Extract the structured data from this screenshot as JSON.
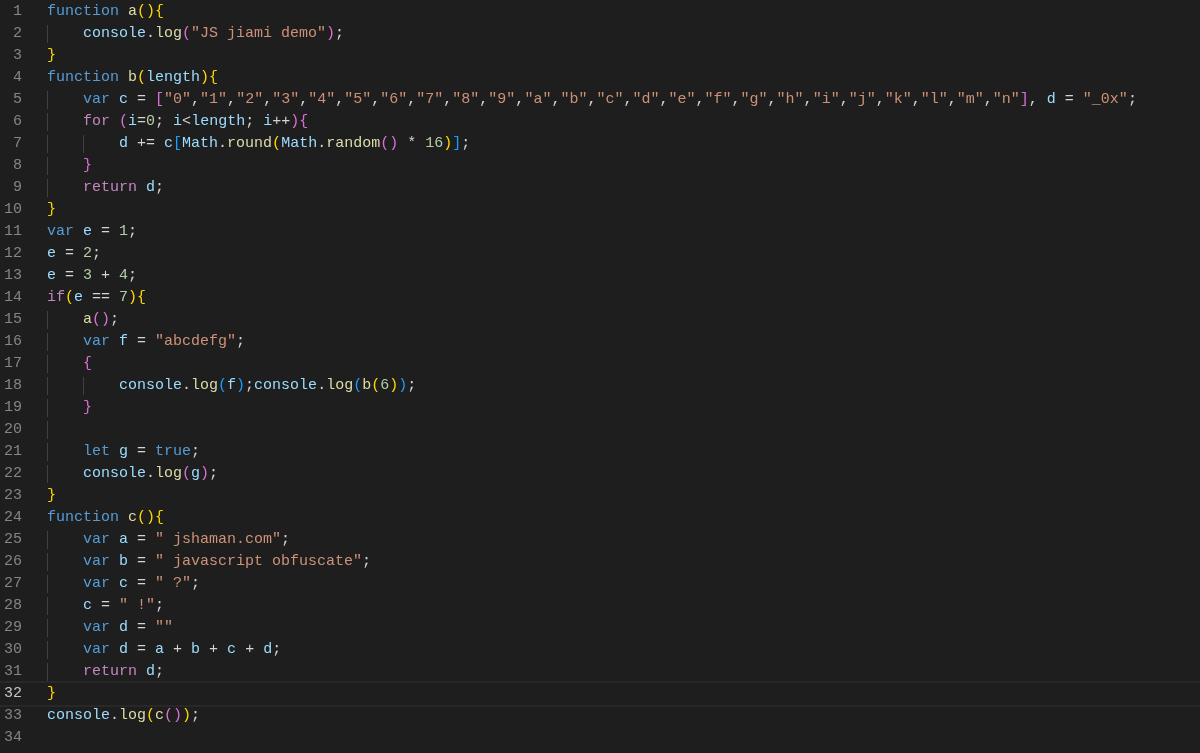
{
  "editor": {
    "lines": [
      {
        "number": "1",
        "current": false,
        "tokens": [
          {
            "text": "function",
            "kind": "keyword"
          },
          {
            "text": " a",
            "kind": "function"
          },
          {
            "text": "()",
            "kind": "bracket1"
          },
          {
            "text": "{",
            "kind": "bracket1"
          }
        ],
        "children": [
          {
            "number": "2",
            "current": false,
            "tokens": [
              {
                "text": "console",
                "kind": "variable"
              },
              {
                "text": ".",
                "kind": "plain"
              },
              {
                "text": "log",
                "kind": "function"
              },
              {
                "text": "(",
                "kind": "bracket2"
              },
              {
                "text": "\"JS jiami demo\"",
                "kind": "string"
              },
              {
                "text": ")",
                "kind": "bracket2"
              },
              {
                "text": ";",
                "kind": "plain"
              }
            ]
          }
        ]
      },
      {
        "number": "3",
        "current": false,
        "tokens": [
          {
            "text": "}",
            "kind": "bracket1"
          }
        ]
      },
      {
        "number": "4",
        "current": false,
        "tokens": [
          {
            "text": "function",
            "kind": "keyword"
          },
          {
            "text": " b",
            "kind": "function"
          },
          {
            "text": "(",
            "kind": "bracket1"
          },
          {
            "text": "length",
            "kind": "variable"
          },
          {
            "text": ")",
            "kind": "bracket1"
          },
          {
            "text": "{",
            "kind": "bracket1"
          }
        ],
        "children": [
          {
            "number": "5",
            "current": false,
            "tokens": [
              {
                "text": "var",
                "kind": "keyword"
              },
              {
                "text": " c",
                "kind": "variable"
              },
              {
                "text": " = ",
                "kind": "plain"
              },
              {
                "text": "[",
                "kind": "bracket2"
              },
              {
                "text": "\"0\"",
                "kind": "string"
              },
              {
                "text": ",",
                "kind": "plain"
              },
              {
                "text": "\"1\"",
                "kind": "string"
              },
              {
                "text": ",",
                "kind": "plain"
              },
              {
                "text": "\"2\"",
                "kind": "string"
              },
              {
                "text": ",",
                "kind": "plain"
              },
              {
                "text": "\"3\"",
                "kind": "string"
              },
              {
                "text": ",",
                "kind": "plain"
              },
              {
                "text": "\"4\"",
                "kind": "string"
              },
              {
                "text": ",",
                "kind": "plain"
              },
              {
                "text": "\"5\"",
                "kind": "string"
              },
              {
                "text": ",",
                "kind": "plain"
              },
              {
                "text": "\"6\"",
                "kind": "string"
              },
              {
                "text": ",",
                "kind": "plain"
              },
              {
                "text": "\"7\"",
                "kind": "string"
              },
              {
                "text": ",",
                "kind": "plain"
              },
              {
                "text": "\"8\"",
                "kind": "string"
              },
              {
                "text": ",",
                "kind": "plain"
              },
              {
                "text": "\"9\"",
                "kind": "string"
              },
              {
                "text": ",",
                "kind": "plain"
              },
              {
                "text": "\"a\"",
                "kind": "string"
              },
              {
                "text": ",",
                "kind": "plain"
              },
              {
                "text": "\"b\"",
                "kind": "string"
              },
              {
                "text": ",",
                "kind": "plain"
              },
              {
                "text": "\"c\"",
                "kind": "string"
              },
              {
                "text": ",",
                "kind": "plain"
              },
              {
                "text": "\"d\"",
                "kind": "string"
              },
              {
                "text": ",",
                "kind": "plain"
              },
              {
                "text": "\"e\"",
                "kind": "string"
              },
              {
                "text": ",",
                "kind": "plain"
              },
              {
                "text": "\"f\"",
                "kind": "string"
              },
              {
                "text": ",",
                "kind": "plain"
              },
              {
                "text": "\"g\"",
                "kind": "string"
              },
              {
                "text": ",",
                "kind": "plain"
              },
              {
                "text": "\"h\"",
                "kind": "string"
              },
              {
                "text": ",",
                "kind": "plain"
              },
              {
                "text": "\"i\"",
                "kind": "string"
              },
              {
                "text": ",",
                "kind": "plain"
              },
              {
                "text": "\"j\"",
                "kind": "string"
              },
              {
                "text": ",",
                "kind": "plain"
              },
              {
                "text": "\"k\"",
                "kind": "string"
              },
              {
                "text": ",",
                "kind": "plain"
              },
              {
                "text": "\"l\"",
                "kind": "string"
              },
              {
                "text": ",",
                "kind": "plain"
              },
              {
                "text": "\"m\"",
                "kind": "string"
              },
              {
                "text": ",",
                "kind": "plain"
              },
              {
                "text": "\"n\"",
                "kind": "string"
              },
              {
                "text": "]",
                "kind": "bracket2"
              },
              {
                "text": ", ",
                "kind": "plain"
              },
              {
                "text": "d",
                "kind": "variable"
              },
              {
                "text": " = ",
                "kind": "plain"
              },
              {
                "text": "\"_0x\"",
                "kind": "string"
              },
              {
                "text": ";",
                "kind": "plain"
              }
            ]
          },
          {
            "number": "6",
            "current": false,
            "tokens": [
              {
                "text": "for",
                "kind": "control"
              },
              {
                "text": " (",
                "kind": "bracket2"
              },
              {
                "text": "i",
                "kind": "variable"
              },
              {
                "text": "=",
                "kind": "plain"
              },
              {
                "text": "0",
                "kind": "number"
              },
              {
                "text": "; ",
                "kind": "plain"
              },
              {
                "text": "i",
                "kind": "variable"
              },
              {
                "text": "<",
                "kind": "plain"
              },
              {
                "text": "length",
                "kind": "variable"
              },
              {
                "text": "; ",
                "kind": "plain"
              },
              {
                "text": "i",
                "kind": "variable"
              },
              {
                "text": "++",
                "kind": "plain"
              },
              {
                "text": ")",
                "kind": "bracket2"
              },
              {
                "text": "{",
                "kind": "bracket2"
              }
            ],
            "children": [
              {
                "number": "7",
                "current": false,
                "tokens": [
                  {
                    "text": "d",
                    "kind": "variable"
                  },
                  {
                    "text": " += ",
                    "kind": "plain"
                  },
                  {
                    "text": "c",
                    "kind": "variable"
                  },
                  {
                    "text": "[",
                    "kind": "bracket3"
                  },
                  {
                    "text": "Math",
                    "kind": "variable"
                  },
                  {
                    "text": ".",
                    "kind": "plain"
                  },
                  {
                    "text": "round",
                    "kind": "function"
                  },
                  {
                    "text": "(",
                    "kind": "bracket1"
                  },
                  {
                    "text": "Math",
                    "kind": "variable"
                  },
                  {
                    "text": ".",
                    "kind": "plain"
                  },
                  {
                    "text": "random",
                    "kind": "function"
                  },
                  {
                    "text": "()",
                    "kind": "bracket2"
                  },
                  {
                    "text": " * ",
                    "kind": "plain"
                  },
                  {
                    "text": "16",
                    "kind": "number"
                  },
                  {
                    "text": ")",
                    "kind": "bracket1"
                  },
                  {
                    "text": "]",
                    "kind": "bracket3"
                  },
                  {
                    "text": ";",
                    "kind": "plain"
                  }
                ]
              }
            ]
          },
          {
            "number": "8",
            "current": false,
            "tokens": [
              {
                "text": "}",
                "kind": "bracket2"
              }
            ]
          },
          {
            "number": "9",
            "current": false,
            "tokens": [
              {
                "text": "return",
                "kind": "control"
              },
              {
                "text": " d",
                "kind": "variable"
              },
              {
                "text": ";",
                "kind": "plain"
              }
            ]
          }
        ]
      },
      {
        "number": "10",
        "current": false,
        "tokens": [
          {
            "text": "}",
            "kind": "bracket1"
          }
        ]
      },
      {
        "number": "11",
        "current": false,
        "tokens": [
          {
            "text": "var",
            "kind": "keyword"
          },
          {
            "text": " e",
            "kind": "variable"
          },
          {
            "text": " = ",
            "kind": "plain"
          },
          {
            "text": "1",
            "kind": "number"
          },
          {
            "text": ";",
            "kind": "plain"
          }
        ]
      },
      {
        "number": "12",
        "current": false,
        "tokens": [
          {
            "text": "e",
            "kind": "variable"
          },
          {
            "text": " = ",
            "kind": "plain"
          },
          {
            "text": "2",
            "kind": "number"
          },
          {
            "text": ";",
            "kind": "plain"
          }
        ]
      },
      {
        "number": "13",
        "current": false,
        "tokens": [
          {
            "text": "e",
            "kind": "variable"
          },
          {
            "text": " = ",
            "kind": "plain"
          },
          {
            "text": "3",
            "kind": "number"
          },
          {
            "text": " + ",
            "kind": "plain"
          },
          {
            "text": "4",
            "kind": "number"
          },
          {
            "text": ";",
            "kind": "plain"
          }
        ]
      },
      {
        "number": "14",
        "current": false,
        "tokens": [
          {
            "text": "if",
            "kind": "control"
          },
          {
            "text": "(",
            "kind": "bracket1"
          },
          {
            "text": "e",
            "kind": "variable"
          },
          {
            "text": " == ",
            "kind": "plain"
          },
          {
            "text": "7",
            "kind": "number"
          },
          {
            "text": ")",
            "kind": "bracket1"
          },
          {
            "text": "{",
            "kind": "bracket1"
          }
        ],
        "children": [
          {
            "number": "15",
            "current": false,
            "tokens": [
              {
                "text": "a",
                "kind": "function"
              },
              {
                "text": "()",
                "kind": "bracket2"
              },
              {
                "text": ";",
                "kind": "plain"
              }
            ]
          },
          {
            "number": "16",
            "current": false,
            "tokens": [
              {
                "text": "var",
                "kind": "keyword"
              },
              {
                "text": " f",
                "kind": "variable"
              },
              {
                "text": " = ",
                "kind": "plain"
              },
              {
                "text": "\"abcdefg\"",
                "kind": "string"
              },
              {
                "text": ";",
                "kind": "plain"
              }
            ]
          },
          {
            "number": "17",
            "current": false,
            "tokens": [
              {
                "text": "{",
                "kind": "bracket2"
              }
            ],
            "children": [
              {
                "number": "18",
                "current": false,
                "tokens": [
                  {
                    "text": "console",
                    "kind": "variable"
                  },
                  {
                    "text": ".",
                    "kind": "plain"
                  },
                  {
                    "text": "log",
                    "kind": "function"
                  },
                  {
                    "text": "(",
                    "kind": "bracket3"
                  },
                  {
                    "text": "f",
                    "kind": "variable"
                  },
                  {
                    "text": ")",
                    "kind": "bracket3"
                  },
                  {
                    "text": ";",
                    "kind": "plain"
                  },
                  {
                    "text": "console",
                    "kind": "variable"
                  },
                  {
                    "text": ".",
                    "kind": "plain"
                  },
                  {
                    "text": "log",
                    "kind": "function"
                  },
                  {
                    "text": "(",
                    "kind": "bracket3"
                  },
                  {
                    "text": "b",
                    "kind": "function"
                  },
                  {
                    "text": "(",
                    "kind": "bracket1"
                  },
                  {
                    "text": "6",
                    "kind": "number"
                  },
                  {
                    "text": ")",
                    "kind": "bracket1"
                  },
                  {
                    "text": ")",
                    "kind": "bracket3"
                  },
                  {
                    "text": ";",
                    "kind": "plain"
                  }
                ]
              }
            ]
          },
          {
            "number": "19",
            "current": false,
            "tokens": [
              {
                "text": "}",
                "kind": "bracket2"
              }
            ]
          },
          {
            "number": "20",
            "current": false
          },
          {
            "number": "21",
            "current": false,
            "tokens": [
              {
                "text": "let",
                "kind": "keyword"
              },
              {
                "text": " g",
                "kind": "variable"
              },
              {
                "text": " = ",
                "kind": "plain"
              },
              {
                "text": "true",
                "kind": "keyword"
              },
              {
                "text": ";",
                "kind": "plain"
              }
            ]
          },
          {
            "number": "22",
            "current": false,
            "tokens": [
              {
                "text": "console",
                "kind": "variable"
              },
              {
                "text": ".",
                "kind": "plain"
              },
              {
                "text": "log",
                "kind": "function"
              },
              {
                "text": "(",
                "kind": "bracket2"
              },
              {
                "text": "g",
                "kind": "variable"
              },
              {
                "text": ")",
                "kind": "bracket2"
              },
              {
                "text": ";",
                "kind": "plain"
              }
            ]
          }
        ]
      },
      {
        "number": "23",
        "current": false,
        "tokens": [
          {
            "text": "}",
            "kind": "bracket1"
          }
        ]
      },
      {
        "number": "24",
        "current": false,
        "tokens": [
          {
            "text": "function",
            "kind": "keyword"
          },
          {
            "text": " c",
            "kind": "function"
          },
          {
            "text": "()",
            "kind": "bracket1"
          },
          {
            "text": "{",
            "kind": "bracket1"
          }
        ],
        "children": [
          {
            "number": "25",
            "current": false,
            "tokens": [
              {
                "text": "var",
                "kind": "keyword"
              },
              {
                "text": " a",
                "kind": "variable"
              },
              {
                "text": " = ",
                "kind": "plain"
              },
              {
                "text": "\" jshaman.com\"",
                "kind": "string"
              },
              {
                "text": ";",
                "kind": "plain"
              }
            ]
          },
          {
            "number": "26",
            "current": false,
            "tokens": [
              {
                "text": "var",
                "kind": "keyword"
              },
              {
                "text": " b",
                "kind": "variable"
              },
              {
                "text": " = ",
                "kind": "plain"
              },
              {
                "text": "\" javascript obfuscate\"",
                "kind": "string"
              },
              {
                "text": ";",
                "kind": "plain"
              }
            ]
          },
          {
            "number": "27",
            "current": false,
            "tokens": [
              {
                "text": "var",
                "kind": "keyword"
              },
              {
                "text": " c",
                "kind": "variable"
              },
              {
                "text": " = ",
                "kind": "plain"
              },
              {
                "text": "\" ?\"",
                "kind": "string"
              },
              {
                "text": ";",
                "kind": "plain"
              }
            ]
          },
          {
            "number": "28",
            "current": false,
            "tokens": [
              {
                "text": "c",
                "kind": "variable"
              },
              {
                "text": " = ",
                "kind": "plain"
              },
              {
                "text": "\" !\"",
                "kind": "string"
              },
              {
                "text": ";",
                "kind": "plain"
              }
            ]
          },
          {
            "number": "29",
            "current": false,
            "tokens": [
              {
                "text": "var",
                "kind": "keyword"
              },
              {
                "text": " d",
                "kind": "variable"
              },
              {
                "text": " = ",
                "kind": "plain"
              },
              {
                "text": "\"\"",
                "kind": "string"
              }
            ]
          },
          {
            "number": "30",
            "current": false,
            "tokens": [
              {
                "text": "var",
                "kind": "keyword"
              },
              {
                "text": " d",
                "kind": "variable"
              },
              {
                "text": " = ",
                "kind": "plain"
              },
              {
                "text": "a",
                "kind": "variable"
              },
              {
                "text": " + ",
                "kind": "plain"
              },
              {
                "text": "b",
                "kind": "variable"
              },
              {
                "text": " + ",
                "kind": "plain"
              },
              {
                "text": "c",
                "kind": "variable"
              },
              {
                "text": " + ",
                "kind": "plain"
              },
              {
                "text": "d",
                "kind": "variable"
              },
              {
                "text": ";",
                "kind": "plain"
              }
            ]
          },
          {
            "number": "31",
            "current": false,
            "tokens": [
              {
                "text": "return",
                "kind": "control"
              },
              {
                "text": " d",
                "kind": "variable"
              },
              {
                "text": ";",
                "kind": "plain"
              }
            ]
          }
        ]
      },
      {
        "number": "32",
        "current": true,
        "tokens": [
          {
            "text": "}",
            "kind": "bracket1"
          }
        ]
      },
      {
        "number": "33",
        "current": false,
        "tokens": [
          {
            "text": "console",
            "kind": "variable"
          },
          {
            "text": ".",
            "kind": "plain"
          },
          {
            "text": "log",
            "kind": "function"
          },
          {
            "text": "(",
            "kind": "bracket1"
          },
          {
            "text": "c",
            "kind": "function"
          },
          {
            "text": "()",
            "kind": "bracket2"
          },
          {
            "text": ")",
            "kind": "bracket1"
          },
          {
            "text": ";",
            "kind": "plain"
          }
        ]
      },
      {
        "number": "34",
        "current": false
      }
    ]
  }
}
